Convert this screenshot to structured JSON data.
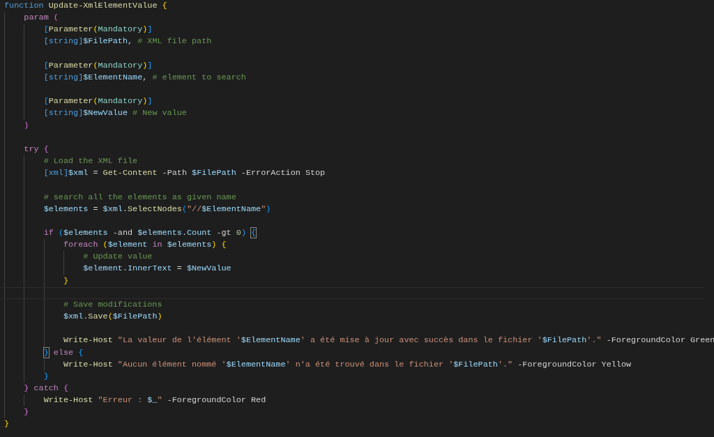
{
  "editor": {
    "lines": [
      {
        "kind": "code",
        "tokens": [
          {
            "text": "function",
            "kind": "storage"
          },
          {
            "text": " Update-XmlElementValue",
            "kind": "function"
          },
          {
            "text": " {",
            "kind": "bracket1"
          }
        ],
        "children": [
          {
            "kind": "code",
            "tokens": [
              {
                "text": "param",
                "kind": "control"
              },
              {
                "text": " (",
                "kind": "bracket2"
              }
            ],
            "children": [
              {
                "kind": "code",
                "tokens": [
                  {
                    "text": "[",
                    "kind": "bracket3"
                  },
                  {
                    "text": "Parameter",
                    "kind": "function"
                  },
                  {
                    "text": "(",
                    "kind": "bracket1"
                  },
                  {
                    "text": "Mandatory",
                    "kind": "attribute"
                  },
                  {
                    "text": ")",
                    "kind": "bracket1"
                  },
                  {
                    "text": "]",
                    "kind": "bracket3"
                  }
                ]
              },
              {
                "kind": "code",
                "tokens": [
                  {
                    "text": "[string]",
                    "kind": "type"
                  },
                  {
                    "text": "$FilePath",
                    "kind": "variable"
                  },
                  {
                    "text": ",",
                    "kind": "plain"
                  },
                  {
                    "text": " # XML file path",
                    "kind": "comment"
                  }
                ]
              },
              {
                "kind": "blank"
              },
              {
                "kind": "code",
                "tokens": [
                  {
                    "text": "[",
                    "kind": "bracket3"
                  },
                  {
                    "text": "Parameter",
                    "kind": "function"
                  },
                  {
                    "text": "(",
                    "kind": "bracket1"
                  },
                  {
                    "text": "Mandatory",
                    "kind": "attribute"
                  },
                  {
                    "text": ")",
                    "kind": "bracket1"
                  },
                  {
                    "text": "]",
                    "kind": "bracket3"
                  }
                ]
              },
              {
                "kind": "code",
                "tokens": [
                  {
                    "text": "[string]",
                    "kind": "type"
                  },
                  {
                    "text": "$ElementName",
                    "kind": "variable"
                  },
                  {
                    "text": ",",
                    "kind": "plain"
                  },
                  {
                    "text": " # element to search",
                    "kind": "comment"
                  }
                ]
              },
              {
                "kind": "blank"
              },
              {
                "kind": "code",
                "tokens": [
                  {
                    "text": "[",
                    "kind": "bracket3"
                  },
                  {
                    "text": "Parameter",
                    "kind": "function"
                  },
                  {
                    "text": "(",
                    "kind": "bracket1"
                  },
                  {
                    "text": "Mandatory",
                    "kind": "attribute"
                  },
                  {
                    "text": ")",
                    "kind": "bracket1"
                  },
                  {
                    "text": "]",
                    "kind": "bracket3"
                  }
                ]
              },
              {
                "kind": "code",
                "tokens": [
                  {
                    "text": "[string]",
                    "kind": "type"
                  },
                  {
                    "text": "$NewValue",
                    "kind": "variable"
                  },
                  {
                    "text": " # New value",
                    "kind": "comment"
                  }
                ]
              }
            ]
          },
          {
            "kind": "code",
            "tokens": [
              {
                "text": ")",
                "kind": "bracket2"
              }
            ]
          },
          {
            "kind": "blank"
          },
          {
            "kind": "code",
            "tokens": [
              {
                "text": "try",
                "kind": "control"
              },
              {
                "text": " {",
                "kind": "bracket2"
              }
            ],
            "children": [
              {
                "kind": "code",
                "tokens": [
                  {
                    "text": "# Load the XML file",
                    "kind": "comment"
                  }
                ]
              },
              {
                "kind": "code",
                "tokens": [
                  {
                    "text": "[xml]",
                    "kind": "type"
                  },
                  {
                    "text": "$xml",
                    "kind": "variable"
                  },
                  {
                    "text": " =",
                    "kind": "plain"
                  },
                  {
                    "text": " Get-Content",
                    "kind": "function"
                  },
                  {
                    "text": " -Path",
                    "kind": "plain"
                  },
                  {
                    "text": " $FilePath",
                    "kind": "variable"
                  },
                  {
                    "text": " -ErrorAction Stop",
                    "kind": "plain"
                  }
                ]
              },
              {
                "kind": "blank"
              },
              {
                "kind": "code",
                "tokens": [
                  {
                    "text": "# search all the elements as given name",
                    "kind": "comment"
                  }
                ]
              },
              {
                "kind": "code",
                "tokens": [
                  {
                    "text": "$elements",
                    "kind": "variable"
                  },
                  {
                    "text": " =",
                    "kind": "plain"
                  },
                  {
                    "text": " $xml",
                    "kind": "variable"
                  },
                  {
                    "text": ".",
                    "kind": "plain"
                  },
                  {
                    "text": "SelectNodes",
                    "kind": "function"
                  },
                  {
                    "text": "(",
                    "kind": "bracket3"
                  },
                  {
                    "text": "\"//",
                    "kind": "string"
                  },
                  {
                    "text": "$ElementName",
                    "kind": "variable"
                  },
                  {
                    "text": "\"",
                    "kind": "string"
                  },
                  {
                    "text": ")",
                    "kind": "bracket3"
                  }
                ]
              },
              {
                "kind": "blank"
              },
              {
                "kind": "code",
                "tokens": [
                  {
                    "text": "if",
                    "kind": "control"
                  },
                  {
                    "text": " (",
                    "kind": "bracket3"
                  },
                  {
                    "text": "$elements",
                    "kind": "variable"
                  },
                  {
                    "text": " -and",
                    "kind": "plain"
                  },
                  {
                    "text": " $elements",
                    "kind": "variable"
                  },
                  {
                    "text": ".Count",
                    "kind": "variable"
                  },
                  {
                    "text": " -gt",
                    "kind": "plain"
                  },
                  {
                    "text": " 0",
                    "kind": "number"
                  },
                  {
                    "text": ") ",
                    "kind": "bracket3"
                  },
                  {
                    "text": "{",
                    "kind": "bracket3",
                    "boxed": true
                  }
                ],
                "children": [
                  {
                    "kind": "code",
                    "tokens": [
                      {
                        "text": "foreach",
                        "kind": "control"
                      },
                      {
                        "text": " (",
                        "kind": "bracket1"
                      },
                      {
                        "text": "$element",
                        "kind": "variable"
                      },
                      {
                        "text": " in",
                        "kind": "control"
                      },
                      {
                        "text": " $elements",
                        "kind": "variable"
                      },
                      {
                        "text": ")",
                        "kind": "bracket1"
                      },
                      {
                        "text": " {",
                        "kind": "bracket1"
                      }
                    ],
                    "children": [
                      {
                        "kind": "code",
                        "tokens": [
                          {
                            "text": "# Update value",
                            "kind": "comment"
                          }
                        ]
                      },
                      {
                        "kind": "code",
                        "tokens": [
                          {
                            "text": "$element",
                            "kind": "variable"
                          },
                          {
                            "text": ".InnerText",
                            "kind": "variable"
                          },
                          {
                            "text": " =",
                            "kind": "plain"
                          },
                          {
                            "text": " $NewValue",
                            "kind": "variable"
                          }
                        ]
                      }
                    ]
                  },
                  {
                    "kind": "code",
                    "tokens": [
                      {
                        "text": "}",
                        "kind": "bracket1"
                      }
                    ]
                  },
                  {
                    "kind": "blank",
                    "current": true
                  },
                  {
                    "kind": "code",
                    "tokens": [
                      {
                        "text": "# Save modifications",
                        "kind": "comment"
                      }
                    ]
                  },
                  {
                    "kind": "code",
                    "tokens": [
                      {
                        "text": "$xml",
                        "kind": "variable"
                      },
                      {
                        "text": ".",
                        "kind": "plain"
                      },
                      {
                        "text": "Save",
                        "kind": "function"
                      },
                      {
                        "text": "(",
                        "kind": "bracket1"
                      },
                      {
                        "text": "$FilePath",
                        "kind": "variable"
                      },
                      {
                        "text": ")",
                        "kind": "bracket1"
                      }
                    ]
                  },
                  {
                    "kind": "blank"
                  },
                  {
                    "kind": "code",
                    "tokens": [
                      {
                        "text": "Write-Host",
                        "kind": "function"
                      },
                      {
                        "text": " \"La valeur de l'élément '",
                        "kind": "string"
                      },
                      {
                        "text": "$ElementName",
                        "kind": "variable"
                      },
                      {
                        "text": "' a été mise à jour avec succès dans le fichier '",
                        "kind": "string"
                      },
                      {
                        "text": "$FilePath",
                        "kind": "variable"
                      },
                      {
                        "text": "'.\"",
                        "kind": "string"
                      },
                      {
                        "text": " -ForegroundColor Green",
                        "kind": "plain"
                      }
                    ]
                  }
                ]
              },
              {
                "kind": "code",
                "tokens": [
                  {
                    "text": "}",
                    "kind": "bracket3",
                    "boxed": true
                  },
                  {
                    "text": " else",
                    "kind": "control"
                  },
                  {
                    "text": " {",
                    "kind": "bracket3"
                  }
                ],
                "children": [
                  {
                    "kind": "code",
                    "tokens": [
                      {
                        "text": "Write-Host",
                        "kind": "function"
                      },
                      {
                        "text": " \"Aucun élément nommé '",
                        "kind": "string"
                      },
                      {
                        "text": "$ElementName",
                        "kind": "variable"
                      },
                      {
                        "text": "' n'a été trouvé dans le fichier '",
                        "kind": "string"
                      },
                      {
                        "text": "$FilePath",
                        "kind": "variable"
                      },
                      {
                        "text": "'.\"",
                        "kind": "string"
                      },
                      {
                        "text": " -ForegroundColor Yellow",
                        "kind": "plain"
                      }
                    ]
                  }
                ]
              },
              {
                "kind": "code",
                "tokens": [
                  {
                    "text": "}",
                    "kind": "bracket3"
                  }
                ]
              }
            ]
          },
          {
            "kind": "code",
            "tokens": [
              {
                "text": "}",
                "kind": "bracket2"
              },
              {
                "text": " catch",
                "kind": "control"
              },
              {
                "text": " {",
                "kind": "bracket2"
              }
            ],
            "children": [
              {
                "kind": "code",
                "tokens": [
                  {
                    "text": "Write-Host",
                    "kind": "function"
                  },
                  {
                    "text": " \"Erreur : ",
                    "kind": "string"
                  },
                  {
                    "text": "$_",
                    "kind": "variable"
                  },
                  {
                    "text": "\"",
                    "kind": "string"
                  },
                  {
                    "text": " -ForegroundColor Red",
                    "kind": "plain"
                  }
                ]
              }
            ]
          },
          {
            "kind": "code",
            "tokens": [
              {
                "text": "}",
                "kind": "bracket2"
              }
            ]
          }
        ]
      },
      {
        "kind": "code",
        "tokens": [
          {
            "text": "}",
            "kind": "bracket1"
          }
        ]
      }
    ]
  }
}
